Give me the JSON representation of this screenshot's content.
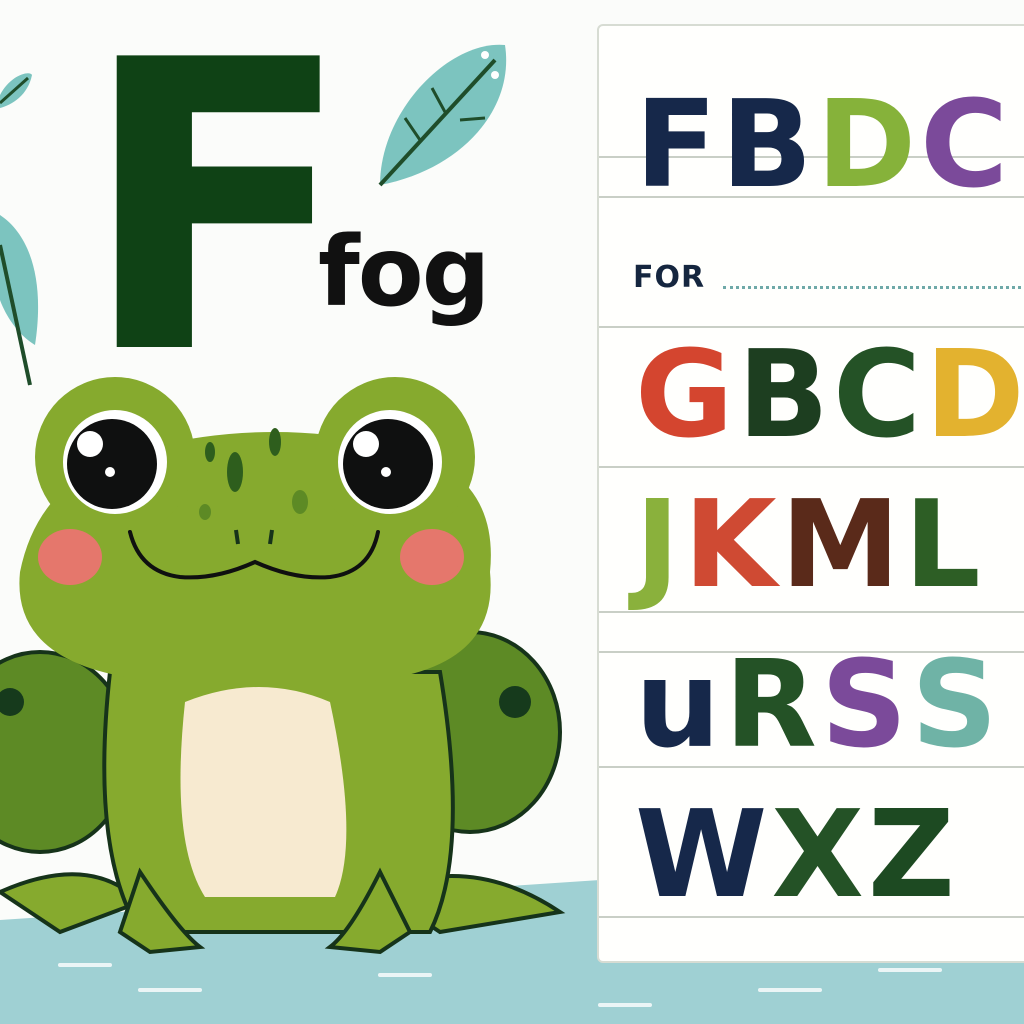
{
  "headline": {
    "letter": "F",
    "word": "fog"
  },
  "chart": {
    "row1": [
      {
        "ch": "F",
        "color": "#16284a"
      },
      {
        "ch": "B",
        "color": "#16284a"
      },
      {
        "ch": "D",
        "color": "#86b23a"
      },
      {
        "ch": "C",
        "color": "#7b4a9a"
      }
    ],
    "for_label": "FOR",
    "row2": [
      {
        "ch": "G",
        "color": "#d4452f"
      },
      {
        "ch": "B",
        "color": "#1d3e20"
      },
      {
        "ch": "C",
        "color": "#245226"
      },
      {
        "ch": "D",
        "color": "#e3b22f"
      }
    ],
    "row3": [
      {
        "ch": "J",
        "color": "#8ab13c"
      },
      {
        "ch": "K",
        "color": "#cf4a33"
      },
      {
        "ch": "M",
        "color": "#5a2a1a"
      },
      {
        "ch": "L",
        "color": "#2d5e25"
      }
    ],
    "row4": [
      {
        "ch": "u",
        "color": "#16284a"
      },
      {
        "ch": "R",
        "color": "#245226"
      },
      {
        "ch": "S",
        "color": "#7b4a9a"
      },
      {
        "ch": "S",
        "color": "#6fb3a6"
      }
    ],
    "row5": [
      {
        "ch": "W",
        "color": "#16284a"
      },
      {
        "ch": "X",
        "color": "#245226"
      },
      {
        "ch": "Z",
        "color": "#1d4a22"
      }
    ]
  },
  "colors": {
    "frog_body": "#86aa2e",
    "frog_dark": "#5d8a25",
    "belly": "#f7ead0",
    "cheek": "#e5776c",
    "water": "#9fd0d3",
    "leaf": "#7cc4bf"
  },
  "icons": [
    "frog-illustration",
    "leaf-icon",
    "water-puddle"
  ]
}
